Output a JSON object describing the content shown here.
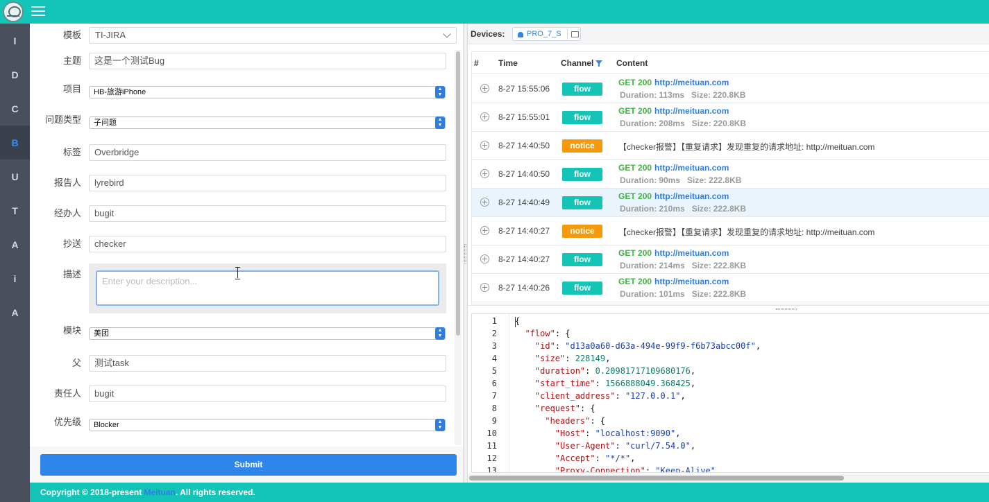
{
  "nav": {
    "items": [
      "I",
      "D",
      "C",
      "B",
      "U",
      "T",
      "A",
      "i",
      "A"
    ],
    "active_index": 3
  },
  "form": {
    "template": {
      "label": "模板",
      "value": "TI-JIRA"
    },
    "subject": {
      "label": "主题",
      "value": "这是一个测试Bug"
    },
    "project": {
      "label": "项目",
      "value": "HB-旅游iPhone"
    },
    "issue_type": {
      "label": "问题类型",
      "value": "子问题"
    },
    "tags": {
      "label": "标签",
      "value": "Overbridge"
    },
    "reporter": {
      "label": "报告人",
      "value": "lyrebird"
    },
    "handler": {
      "label": "经办人",
      "value": "bugit"
    },
    "cc": {
      "label": "抄送",
      "value": "checker"
    },
    "description": {
      "label": "描述",
      "placeholder": "Enter your description..."
    },
    "module": {
      "label": "模块",
      "value": "美团"
    },
    "parent": {
      "label": "父",
      "value": "测试task"
    },
    "owner": {
      "label": "责任人",
      "value": "bugit"
    },
    "priority": {
      "label": "优先级",
      "value": "Blocker"
    },
    "submit_label": "Submit"
  },
  "devices": {
    "label": "Devices:",
    "device_name": "PRO_7_S"
  },
  "flow_table": {
    "headers": {
      "index": "#",
      "time": "Time",
      "channel": "Channel",
      "content": "Content"
    },
    "duration_label": "Duration:",
    "size_label": "Size:",
    "rows": [
      {
        "time": "8-27 15:55:06",
        "channel": "flow",
        "method": "GET",
        "status": "200",
        "url": "http://meituan.com",
        "duration": "113ms",
        "size": "220.8KB"
      },
      {
        "time": "8-27 15:55:01",
        "channel": "flow",
        "method": "GET",
        "status": "200",
        "url": "http://meituan.com",
        "duration": "208ms",
        "size": "220.8KB"
      },
      {
        "time": "8-27 14:40:50",
        "channel": "notice",
        "message": "【checker报警】【重复请求】发现重复的请求地址: http://meituan.com"
      },
      {
        "time": "8-27 14:40:50",
        "channel": "flow",
        "method": "GET",
        "status": "200",
        "url": "http://meituan.com",
        "duration": "90ms",
        "size": "222.8KB"
      },
      {
        "time": "8-27 14:40:49",
        "channel": "flow",
        "method": "GET",
        "status": "200",
        "url": "http://meituan.com",
        "duration": "210ms",
        "size": "222.8KB",
        "selected": true
      },
      {
        "time": "8-27 14:40:27",
        "channel": "notice",
        "message": "【checker报警】【重复请求】发现重复的请求地址: http://meituan.com"
      },
      {
        "time": "8-27 14:40:27",
        "channel": "flow",
        "method": "GET",
        "status": "200",
        "url": "http://meituan.com",
        "duration": "214ms",
        "size": "222.8KB"
      },
      {
        "time": "8-27 14:40:26",
        "channel": "flow",
        "method": "GET",
        "status": "200",
        "url": "http://meituan.com",
        "duration": "101ms",
        "size": "222.8KB"
      }
    ]
  },
  "code_lines": [
    {
      "n": "1",
      "html": "{"
    },
    {
      "n": "2",
      "html": "  <span class=\"k\">\"flow\"</span>: {"
    },
    {
      "n": "3",
      "html": "    <span class=\"k\">\"id\"</span>: <span class=\"s\">\"d13a0a60-d63a-494e-99f9-f6b73abcc00f\"</span>,"
    },
    {
      "n": "4",
      "html": "    <span class=\"k\">\"size\"</span>: <span class=\"n\">228149</span>,"
    },
    {
      "n": "5",
      "html": "    <span class=\"k\">\"duration\"</span>: <span class=\"n\">0.20981717109680176</span>,"
    },
    {
      "n": "6",
      "html": "    <span class=\"k\">\"start_time\"</span>: <span class=\"n\">1566888049.368425</span>,"
    },
    {
      "n": "7",
      "html": "    <span class=\"k\">\"client_address\"</span>: <span class=\"s\">\"127.0.0.1\"</span>,"
    },
    {
      "n": "8",
      "html": "    <span class=\"k\">\"request\"</span>: {"
    },
    {
      "n": "9",
      "html": "      <span class=\"k\">\"headers\"</span>: {"
    },
    {
      "n": "10",
      "html": "        <span class=\"k\">\"Host\"</span>: <span class=\"s\">\"localhost:9090\"</span>,"
    },
    {
      "n": "11",
      "html": "        <span class=\"k\">\"User-Agent\"</span>: <span class=\"s\">\"curl/7.54.0\"</span>,"
    },
    {
      "n": "12",
      "html": "        <span class=\"k\">\"Accept\"</span>: <span class=\"s\">\"*/*\"</span>,"
    },
    {
      "n": "13",
      "html": "        <span class=\"k\">\"Proxy-Connection\"</span>: <span class=\"s\">\"Keep-Alive\"</span>"
    }
  ],
  "footer": {
    "prefix": "Copyright © 2018-present ",
    "brand": "Meituan",
    "suffix": ". All rights reserved."
  },
  "colors": {
    "brand_teal": "#13c5b8",
    "primary_blue": "#2f86ea",
    "notice_orange": "#f59a0c",
    "method_green": "#3fb63f",
    "sidebar_dark": "#4a4f5e"
  }
}
